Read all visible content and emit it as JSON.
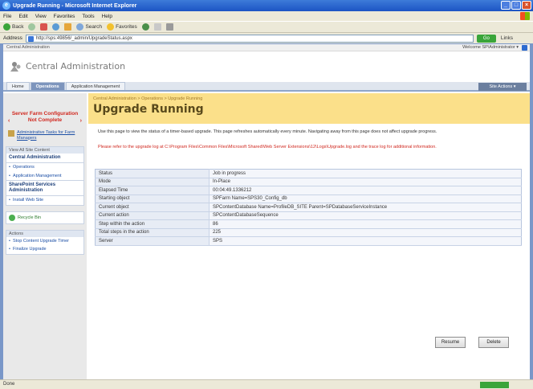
{
  "browser": {
    "title": "Upgrade Running - Microsoft Internet Explorer",
    "menu": [
      "File",
      "Edit",
      "View",
      "Favorites",
      "Tools",
      "Help"
    ],
    "toolbar": {
      "back": "Back",
      "search": "Search",
      "favorites": "Favorites"
    },
    "address_label": "Address",
    "address_url": "http://sps:49856/_admin/UpgradeStatus.aspx",
    "go_label": "Go",
    "links_label": "Links",
    "status_text": "Done"
  },
  "sharepoint": {
    "topbar_label": "Central Administration",
    "welcome": "Welcome SP\\Administrator ▾",
    "site_title": "Central Administration",
    "tabs": [
      "Home",
      "Operations",
      "Application Management"
    ],
    "active_tab": 1,
    "site_actions": "Site Actions ▾"
  },
  "leftnav": {
    "error_text": "Server Farm Configuration Not Complete",
    "admin_link": "Administrative Tasks for Farm Managers",
    "view_all": "View All Site Content",
    "sections": [
      {
        "title": "Central Administration",
        "items": [
          "Operations",
          "Application Management"
        ]
      },
      {
        "title": "SharePoint Services Administration",
        "items": [
          "Install Web Site"
        ]
      }
    ],
    "recycle_bin": "Recycle Bin",
    "actions_header": "Actions",
    "actions": [
      "Stop Content Upgrade Timer",
      "Finalize Upgrade"
    ]
  },
  "main": {
    "breadcrumb": "Central Administration > Operations > Upgrade Running",
    "title": "Upgrade Running",
    "description": "Use this page to view the status of a timer-based upgrade. This page refreshes automatically every minute. Navigating away from this page does not affect upgrade progress.",
    "warning": "Please refer to the upgrade log at C:\\Program Files\\Common Files\\Microsoft Shared\\Web Server Extensions\\12\\Logs\\Upgrade.log and the trace log for additional information.",
    "rows": [
      {
        "label": "Status",
        "value": "Job in progress"
      },
      {
        "label": "Mode",
        "value": "In-Place"
      },
      {
        "label": "Elapsed Time",
        "value": "00:04:49.1336212"
      },
      {
        "label": "Starting object",
        "value": "SPFarm Name=SPS30_Config_db"
      },
      {
        "label": "Current object",
        "value": "SPContentDatabase Name=ProfileDB_SITE Parent=SPDatabaseServiceInstance"
      },
      {
        "label": "Current action",
        "value": "SPContentDatabaseSequence"
      },
      {
        "label": "Step within the action",
        "value": "86"
      },
      {
        "label": "Total steps in the action",
        "value": "225"
      },
      {
        "label": "Server",
        "value": "SPS"
      }
    ],
    "resume_label": "Resume",
    "delete_label": "Delete"
  }
}
